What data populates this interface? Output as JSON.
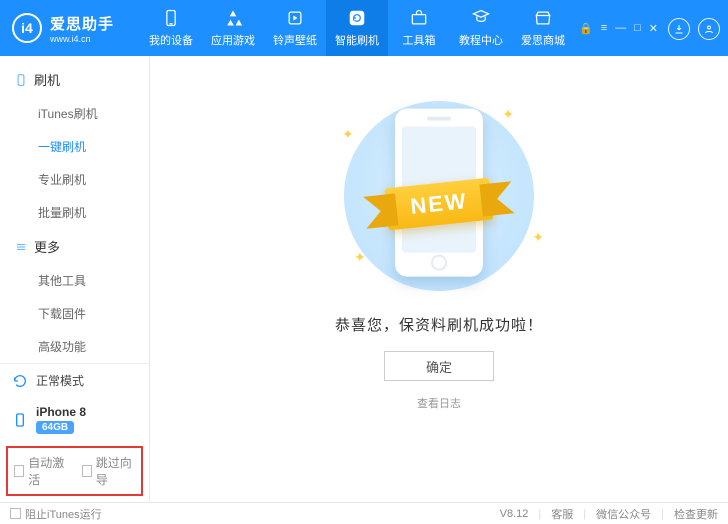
{
  "brand": {
    "logo_text": "i4",
    "name_cn": "爱思助手",
    "name_en": "www.i4.cn"
  },
  "topnav": [
    {
      "icon": "phone",
      "label": "我的设备"
    },
    {
      "icon": "apps",
      "label": "应用游戏"
    },
    {
      "icon": "ringtone",
      "label": "铃声壁纸"
    },
    {
      "icon": "refresh",
      "label": "智能刷机",
      "active": true
    },
    {
      "icon": "toolbox",
      "label": "工具箱"
    },
    {
      "icon": "tutorial",
      "label": "教程中心"
    },
    {
      "icon": "store",
      "label": "爱思商城"
    }
  ],
  "sidebar": {
    "groups": [
      {
        "icon": "device",
        "title": "刷机",
        "items": [
          {
            "label": "iTunes刷机"
          },
          {
            "label": "一键刷机",
            "active": true
          },
          {
            "label": "专业刷机"
          },
          {
            "label": "批量刷机"
          }
        ]
      },
      {
        "icon": "more",
        "title": "更多",
        "items": [
          {
            "label": "其他工具"
          },
          {
            "label": "下载固件"
          },
          {
            "label": "高级功能"
          }
        ]
      }
    ],
    "mode_label": "正常模式",
    "device_name": "iPhone 8",
    "device_badge": "64GB",
    "highlighted_options": {
      "auto_activate": "自动激活",
      "skip_guide": "跳过向导"
    }
  },
  "main": {
    "ribbon_text": "NEW",
    "success_text": "恭喜您，保资料刷机成功啦！",
    "ok_button": "确定",
    "log_link": "查看日志"
  },
  "footer": {
    "block_itunes": "阻止iTunes运行",
    "version": "V8.12",
    "links": {
      "service": "客服",
      "wechat": "微信公众号",
      "update": "检查更新"
    }
  }
}
